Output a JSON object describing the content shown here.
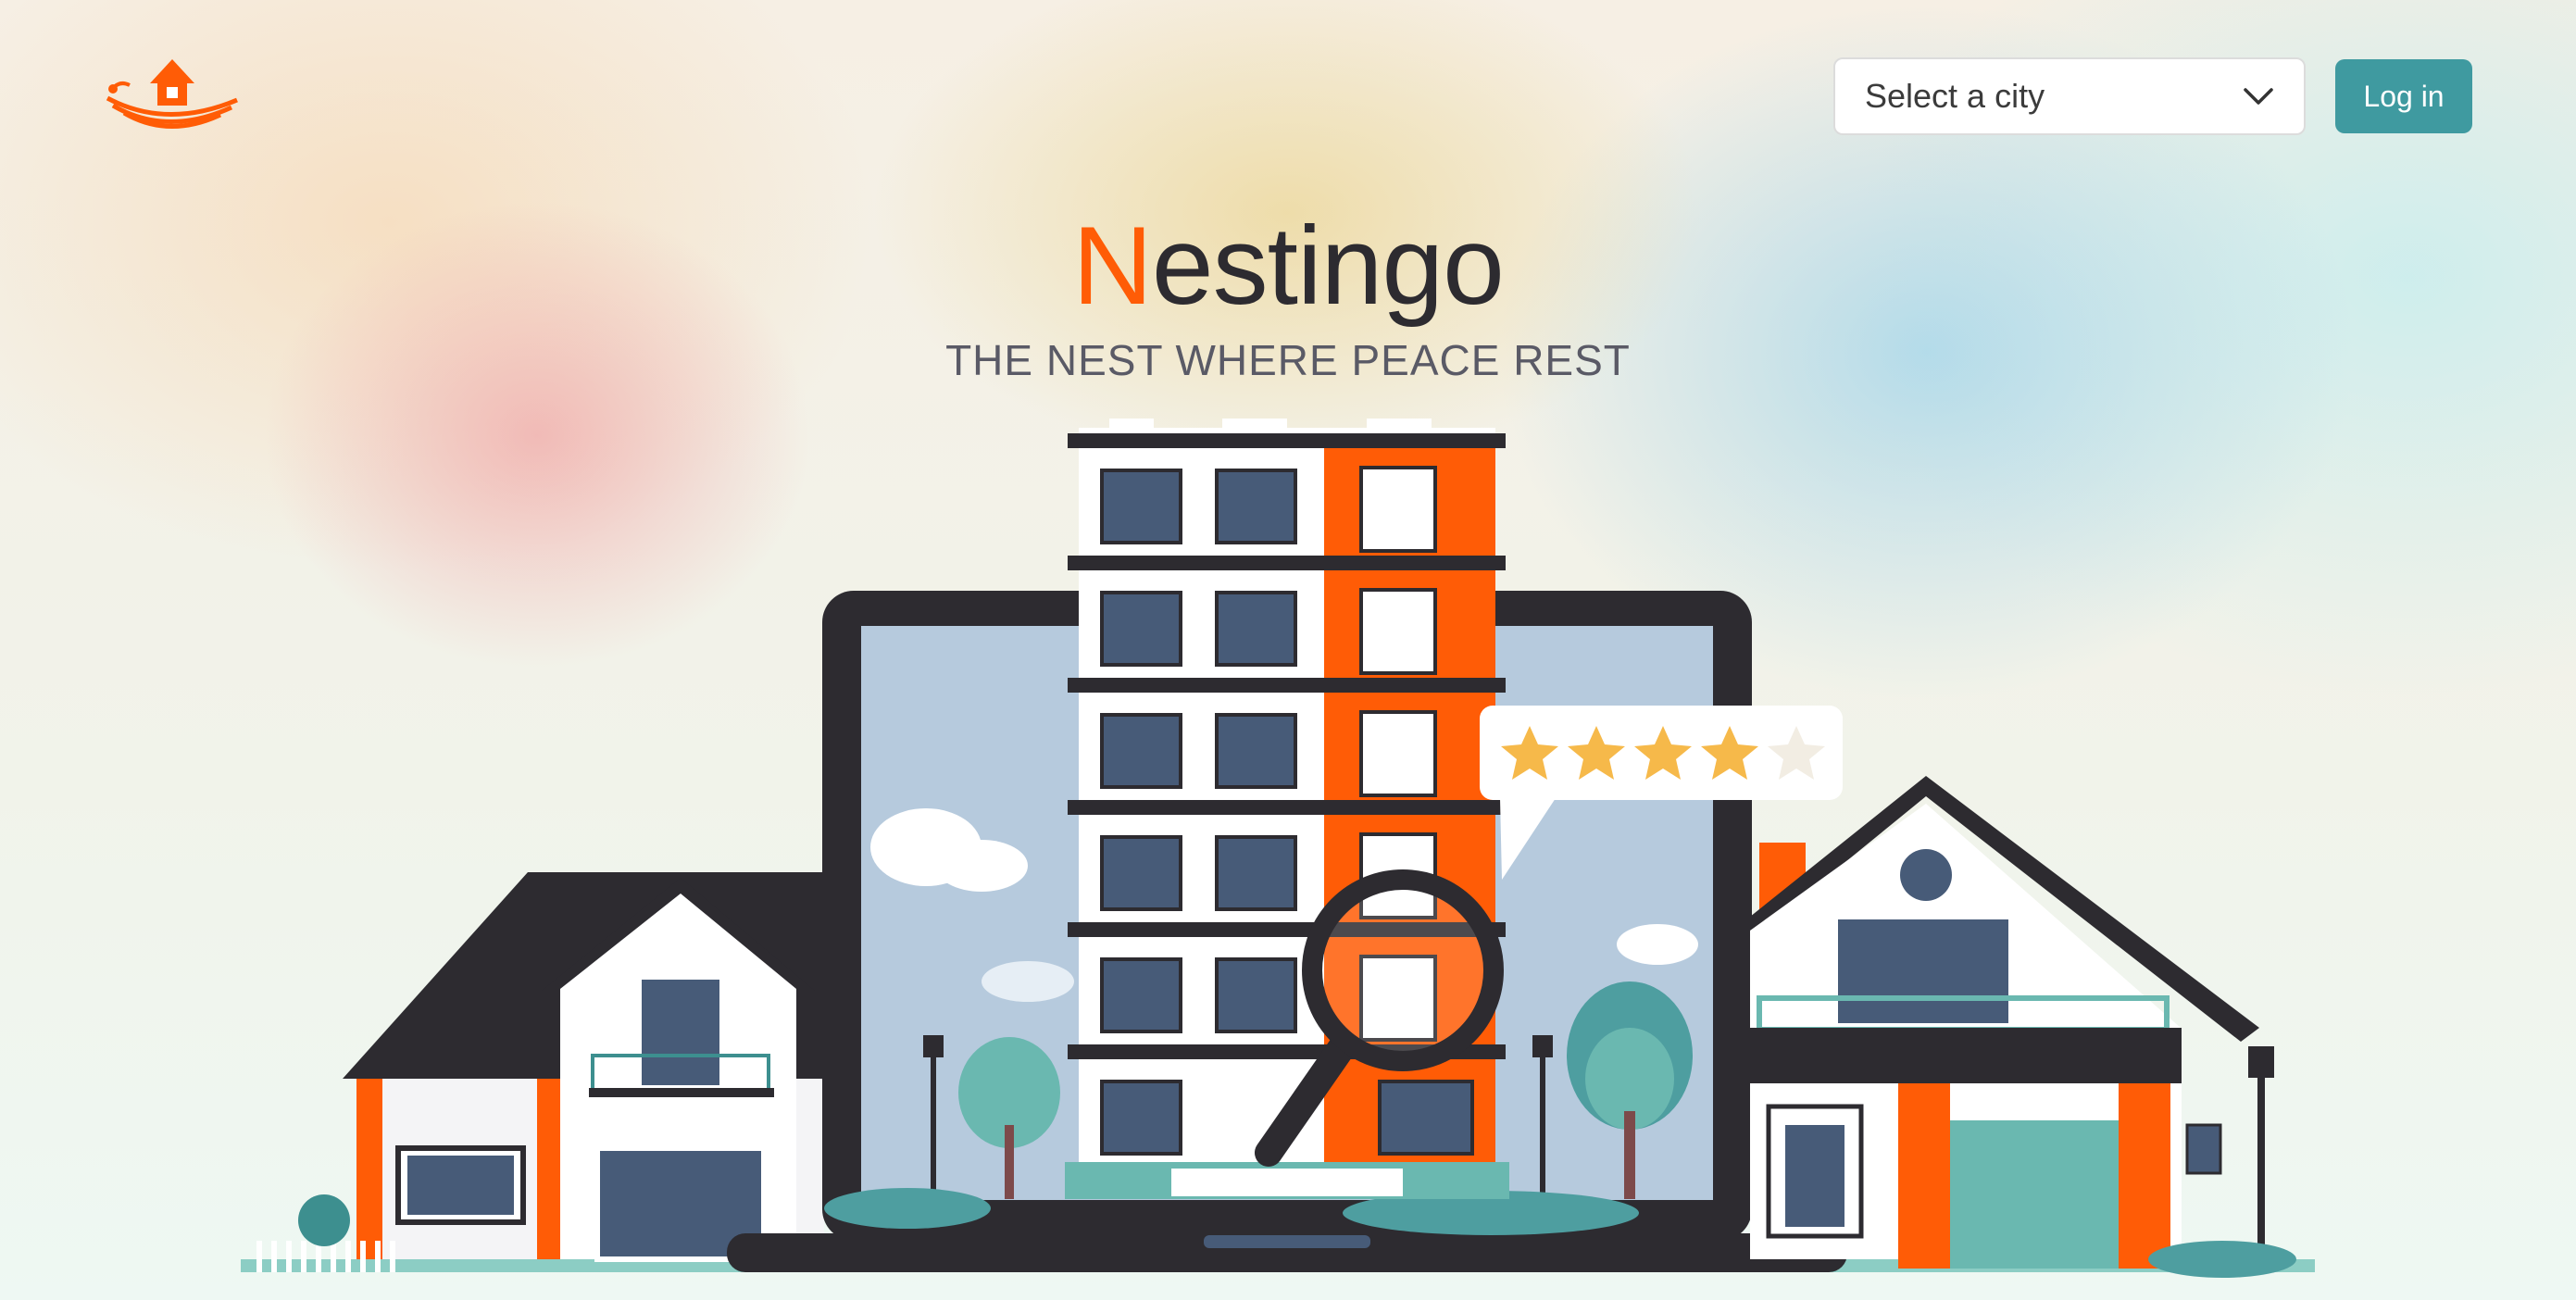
{
  "header": {
    "logo_icon": "nest-house-logo",
    "city_select": {
      "placeholder": "Select a city",
      "icon": "chevron-down-icon"
    },
    "login_label": "Log in"
  },
  "hero": {
    "brand_first_letter": "N",
    "brand_rest": "estingo",
    "tagline": "THE NEST WHERE PEACE REST",
    "rating_stars_filled": 4,
    "rating_stars_total": 5
  },
  "colors": {
    "brand_orange": "#ff5c06",
    "teal_button": "#3f9aa0",
    "dark": "#2d2b30",
    "star": "#f6b94a",
    "window": "#475b78"
  }
}
